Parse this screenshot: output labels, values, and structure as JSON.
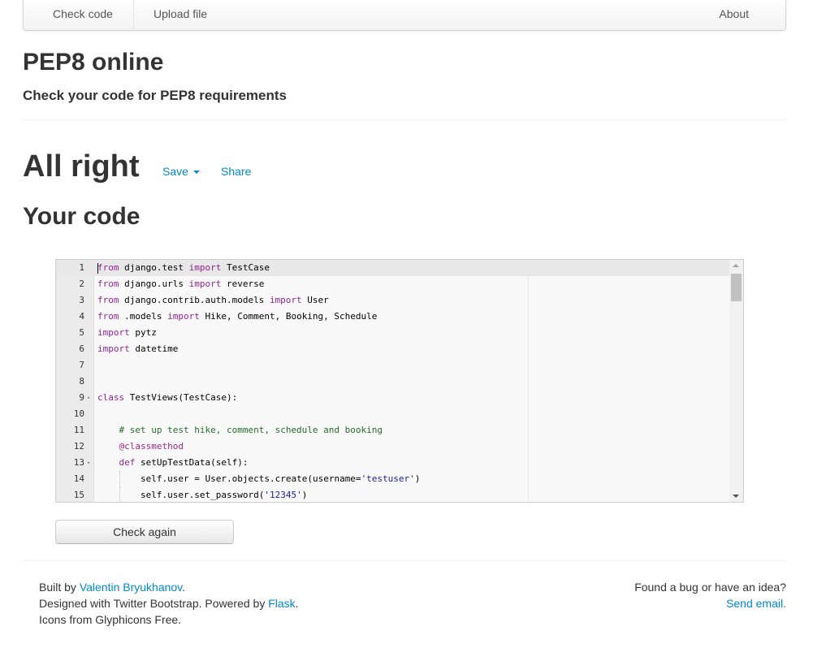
{
  "nav": {
    "check_code": "Check code",
    "upload_file": "Upload file",
    "about": "About"
  },
  "header": {
    "title": "PEP8 online",
    "subtitle": "Check your code for PEP8 requirements"
  },
  "result": {
    "heading": "All right",
    "save_label": "Save",
    "share_label": "Share"
  },
  "code_section": {
    "heading": "Your code"
  },
  "editor": {
    "active_line": 1,
    "lines": [
      {
        "n": "1",
        "fold": false,
        "indent": 0,
        "tokens": [
          {
            "t": "from",
            "c": "kw"
          },
          {
            "t": " django.test "
          },
          {
            "t": "import",
            "c": "kw"
          },
          {
            "t": " TestCase"
          }
        ]
      },
      {
        "n": "2",
        "fold": false,
        "indent": 0,
        "tokens": [
          {
            "t": "from",
            "c": "kw"
          },
          {
            "t": " django.urls "
          },
          {
            "t": "import",
            "c": "kw"
          },
          {
            "t": " reverse"
          }
        ]
      },
      {
        "n": "3",
        "fold": false,
        "indent": 0,
        "tokens": [
          {
            "t": "from",
            "c": "kw"
          },
          {
            "t": " django.contrib.auth.models "
          },
          {
            "t": "import",
            "c": "kw"
          },
          {
            "t": " User"
          }
        ]
      },
      {
        "n": "4",
        "fold": false,
        "indent": 0,
        "tokens": [
          {
            "t": "from",
            "c": "kw"
          },
          {
            "t": " .models "
          },
          {
            "t": "import",
            "c": "kw"
          },
          {
            "t": " Hike, Comment, Booking, Schedule"
          }
        ]
      },
      {
        "n": "5",
        "fold": false,
        "indent": 0,
        "tokens": [
          {
            "t": "import",
            "c": "kw"
          },
          {
            "t": " pytz"
          }
        ]
      },
      {
        "n": "6",
        "fold": false,
        "indent": 0,
        "tokens": [
          {
            "t": "import",
            "c": "kw"
          },
          {
            "t": " datetime"
          }
        ]
      },
      {
        "n": "7",
        "fold": false,
        "indent": 0,
        "tokens": []
      },
      {
        "n": "8",
        "fold": false,
        "indent": 0,
        "tokens": []
      },
      {
        "n": "9",
        "fold": true,
        "indent": 0,
        "tokens": [
          {
            "t": "class",
            "c": "kw"
          },
          {
            "t": " TestViews(TestCase):"
          }
        ]
      },
      {
        "n": "10",
        "fold": false,
        "indent": 0,
        "tokens": []
      },
      {
        "n": "11",
        "fold": false,
        "indent": 1,
        "tokens": [
          {
            "t": "# set up test hike, comment, schedule and booking",
            "c": "cm"
          }
        ]
      },
      {
        "n": "12",
        "fold": false,
        "indent": 1,
        "tokens": [
          {
            "t": "@classmethod",
            "c": "dec"
          }
        ]
      },
      {
        "n": "13",
        "fold": true,
        "indent": 1,
        "tokens": [
          {
            "t": "def",
            "c": "kw"
          },
          {
            "t": " setUpTestData(self):"
          }
        ]
      },
      {
        "n": "14",
        "fold": false,
        "indent": 2,
        "tokens": [
          {
            "t": "self.user = User.objects.create(username="
          },
          {
            "t": "'testuser'",
            "c": "st"
          },
          {
            "t": ")"
          }
        ]
      },
      {
        "n": "15",
        "fold": false,
        "indent": 2,
        "tokens": [
          {
            "t": "self.user.set_password("
          },
          {
            "t": "'12345'",
            "c": "st"
          },
          {
            "t": ")"
          }
        ]
      }
    ]
  },
  "actions": {
    "check_again": "Check again"
  },
  "footer": {
    "built_by_prefix": "Built by ",
    "author": "Valentin Bryukhanov",
    "built_by_suffix": ".",
    "designed_prefix": "Designed with Twitter Bootstrap. Powered by ",
    "flask": "Flask",
    "designed_suffix": ".",
    "icons_line": "Icons from Glyphicons Free.",
    "bug_line": "Found a bug or have an idea?",
    "send_email": "Send email."
  }
}
